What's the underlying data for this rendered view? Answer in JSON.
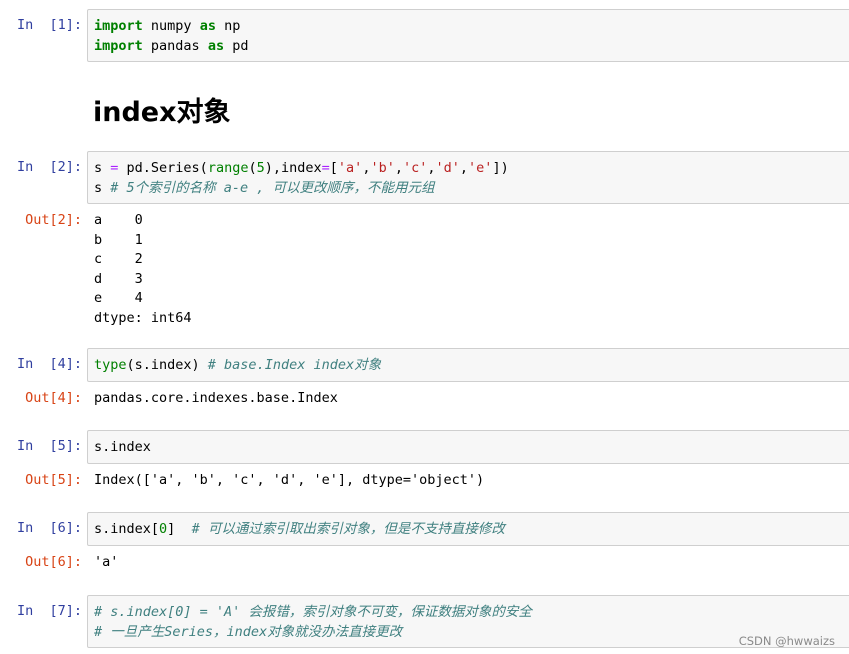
{
  "cells": {
    "c1": {
      "prompt": "In  [1]:",
      "l1": {
        "t1": "import",
        "t2": " numpy ",
        "t3": "as",
        "t4": " np"
      },
      "l2": {
        "t1": "import",
        "t2": " pandas ",
        "t3": "as",
        "t4": " pd"
      }
    },
    "heading": "index对象",
    "c2": {
      "prompt": "In  [2]:",
      "l1": {
        "t1": "s ",
        "t2": "=",
        "t3": " pd.Series(",
        "t4": "range",
        "t5": "(",
        "t6": "5",
        "t7": "),index",
        "t8": "=",
        "t9": "[",
        "t10": "'a'",
        "t11": ",",
        "t12": "'b'",
        "t13": ",",
        "t14": "'c'",
        "t15": ",",
        "t16": "'d'",
        "t17": ",",
        "t18": "'e'",
        "t19": "])"
      },
      "l2": {
        "t1": "s ",
        "t2": "# 5个索引的名称 a-e , 可以更改顺序，不能用元组"
      },
      "out_prompt": "Out[2]:",
      "output": [
        "a    0",
        "b    1",
        "c    2",
        "d    3",
        "e    4",
        "dtype: int64"
      ]
    },
    "c4": {
      "prompt": "In  [4]:",
      "l1": {
        "t1": "type",
        "t2": "(s.index) ",
        "t3": "# base.Index index对象"
      },
      "out_prompt": "Out[4]:",
      "output": "pandas.core.indexes.base.Index"
    },
    "c5": {
      "prompt": "In  [5]:",
      "l1": {
        "t1": "s.index"
      },
      "out_prompt": "Out[5]:",
      "output": "Index(['a', 'b', 'c', 'd', 'e'], dtype='object')"
    },
    "c6": {
      "prompt": "In  [6]:",
      "l1": {
        "t1": "s.index[",
        "t2": "0",
        "t3": "]  ",
        "t4": "# 可以通过索引取出索引对象，但是不支持直接修改"
      },
      "out_prompt": "Out[6]:",
      "output": "'a'"
    },
    "c7": {
      "prompt": "In  [7]:",
      "l1": {
        "t1": "# s.index[0] = 'A' 会报错，索引对象不可变，保证数据对象的安全"
      },
      "l2": {
        "t1": "# 一旦产生Series，index对象就没办法直接更改"
      }
    }
  },
  "watermark": "CSDN @hwwaizs",
  "colors": {
    "in_prompt": "#303f9f",
    "out_prompt": "#d84315",
    "keyword": "#008000",
    "string": "#ba2121",
    "operator": "#aa22ff",
    "comment": "#408080",
    "cell_bg": "#f7f7f7",
    "cell_border": "#cfcfcf"
  }
}
